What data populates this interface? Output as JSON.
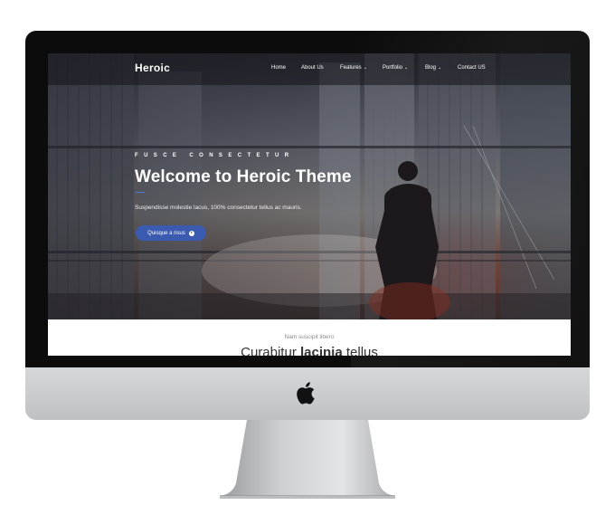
{
  "site": {
    "brand": "Heroic",
    "nav": [
      {
        "label": "Home",
        "has_caret": false
      },
      {
        "label": "About Us",
        "has_caret": false
      },
      {
        "label": "Features",
        "has_caret": true
      },
      {
        "label": "Portfolio",
        "has_caret": true
      },
      {
        "label": "Blog",
        "has_caret": true
      },
      {
        "label": "Contact US",
        "has_caret": false
      }
    ],
    "caret_glyph": "⌄"
  },
  "hero": {
    "eyebrow": "FUSCE CONSECTETUR",
    "title": "Welcome to Heroic Theme",
    "subtitle": "Suspendisse molestie lacus, 100% consectetur tellus ac mauris.",
    "cta_label": "Quisque a risus",
    "cta_icon": "arrow-circle-right-icon"
  },
  "section": {
    "eyebrow": "Nam suscipit libero",
    "title_regular": "Curabitur ",
    "title_bold": "lacinia",
    "title_tail": " tellus"
  },
  "colors": {
    "accent": "#3b5bb0",
    "bezel": "#0c0c0c",
    "chin": "#cfd0d2"
  },
  "device": {
    "logo": "apple-logo-icon"
  }
}
